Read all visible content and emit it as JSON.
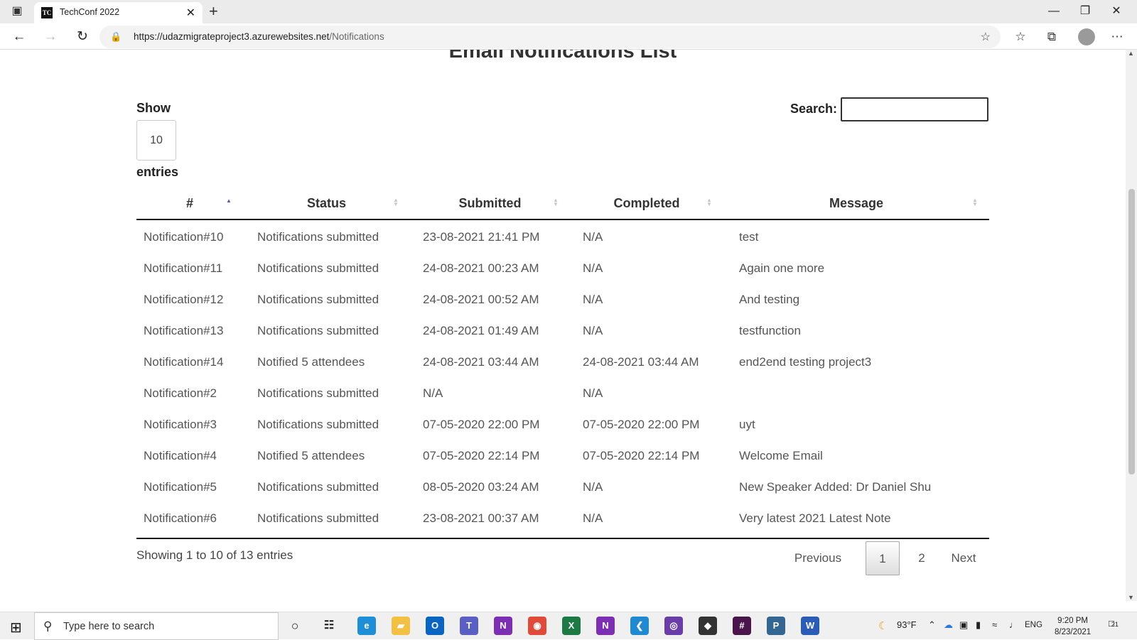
{
  "browser": {
    "tab_title": "TechConf 2022",
    "tab_favicon_text": "TC",
    "url_host": "https://udazmigrateproject3.azurewebsites.net",
    "url_path": "/Notifications"
  },
  "page": {
    "title": "Email Notifications List",
    "length_label": "Show",
    "length_value": "10",
    "length_suffix": "entries",
    "search_label": "Search:",
    "search_value": ""
  },
  "table": {
    "headers": [
      "#",
      "Status",
      "Submitted",
      "Completed",
      "Message"
    ],
    "sorted_column": "#",
    "sort_direction": "ascending",
    "rows": [
      [
        "Notification#10",
        "Notifications submitted",
        "23-08-2021 21:41 PM",
        "N/A",
        "test"
      ],
      [
        "Notification#11",
        "Notifications submitted",
        "24-08-2021 00:23 AM",
        "N/A",
        "Again one more"
      ],
      [
        "Notification#12",
        "Notifications submitted",
        "24-08-2021 00:52 AM",
        "N/A",
        "And testing"
      ],
      [
        "Notification#13",
        "Notifications submitted",
        "24-08-2021 01:49 AM",
        "N/A",
        "testfunction"
      ],
      [
        "Notification#14",
        "Notified 5 attendees",
        "24-08-2021 03:44 AM",
        "24-08-2021 03:44 AM",
        "end2end testing project3"
      ],
      [
        "Notification#2",
        "Notifications submitted",
        "N/A",
        "N/A",
        ""
      ],
      [
        "Notification#3",
        "Notifications submitted",
        "07-05-2020 22:00 PM",
        "07-05-2020 22:00 PM",
        "uyt"
      ],
      [
        "Notification#4",
        "Notified 5 attendees",
        "07-05-2020 22:14 PM",
        "07-05-2020 22:14 PM",
        "Welcome Email"
      ],
      [
        "Notification#5",
        "Notifications submitted",
        "08-05-2020 03:24 AM",
        "N/A",
        "New Speaker Added: Dr Daniel Shu"
      ],
      [
        "Notification#6",
        "Notifications submitted",
        "23-08-2021 00:37 AM",
        "N/A",
        "Very latest 2021 Latest Note"
      ]
    ],
    "info": "Showing 1 to 10 of 13 entries"
  },
  "pagination": {
    "previous": "Previous",
    "pages": [
      "1",
      "2"
    ],
    "current_page": "1",
    "next": "Next"
  },
  "taskbar": {
    "search_placeholder": "Type here to search",
    "weather": "93°F",
    "language": "ENG",
    "time": "9:20 PM",
    "date": "8/23/2021",
    "notification_count": "21",
    "apps": [
      "edge-icon",
      "file-explorer-icon",
      "outlook-icon",
      "teams-icon",
      "onenote-icon",
      "chrome-icon",
      "excel-icon",
      "onenote-icon",
      "vscode-icon",
      "github-icon",
      "unity-icon",
      "slack-icon",
      "postgres-icon",
      "word-icon"
    ]
  },
  "colors": {
    "accent_sort": "#555ab0",
    "table_border": "#111111",
    "text_muted": "#555555"
  }
}
